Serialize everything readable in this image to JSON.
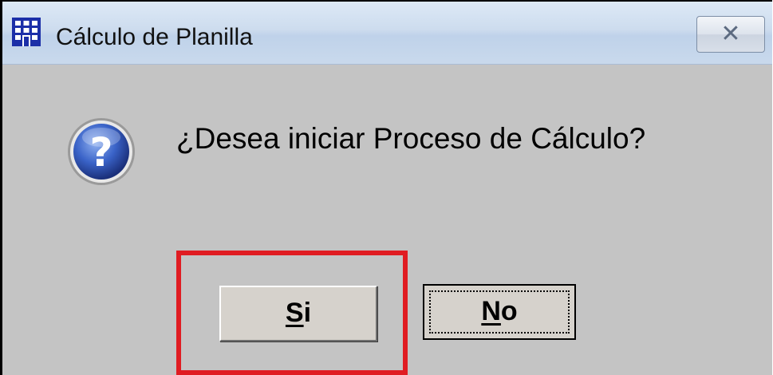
{
  "window": {
    "title": "Cálculo de Planilla",
    "app_icon": "building-icon",
    "close_icon": "close-icon"
  },
  "dialog": {
    "icon": "question-icon",
    "message": "¿Desea iniciar Proceso de Cálculo?"
  },
  "buttons": {
    "yes": {
      "mnemonic": "S",
      "rest": "i"
    },
    "no": {
      "mnemonic": "N",
      "rest": "o"
    }
  },
  "annotation": {
    "highlight_color": "#e01c22"
  }
}
